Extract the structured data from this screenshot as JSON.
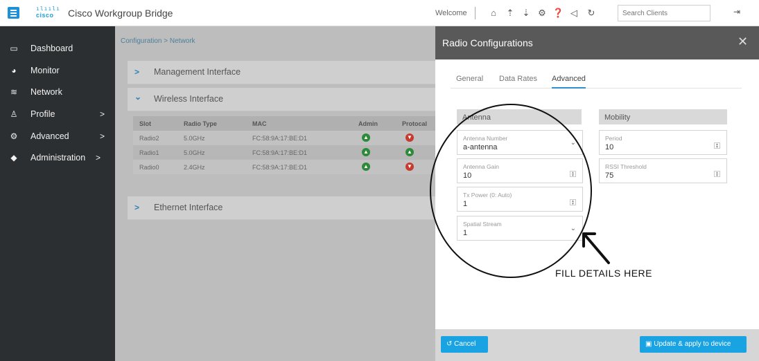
{
  "header": {
    "logo_word": "cisco",
    "logo_bars": "ılıılı",
    "title": "Cisco Workgroup Bridge",
    "welcome": "Welcome",
    "search_placeholder": "Search Clients",
    "icons": [
      "home-icon",
      "upload-icon",
      "download-icon",
      "gear-icon",
      "help-icon",
      "megaphone-icon",
      "refresh-icon",
      "logout-icon"
    ]
  },
  "sidebar": {
    "items": [
      {
        "label": "Dashboard",
        "icon": "dashboard-icon"
      },
      {
        "label": "Monitor",
        "icon": "monitor-icon"
      },
      {
        "label": "Network",
        "icon": "wifi-icon"
      },
      {
        "label": "Profile",
        "icon": "profile-icon",
        "chevron": ">"
      },
      {
        "label": "Advanced",
        "icon": "cogs-icon",
        "chevron": ">"
      },
      {
        "label": "Administration",
        "icon": "wrench-icon",
        "chevron": ">"
      }
    ]
  },
  "main": {
    "breadcrumb": "Configuration > Network",
    "panels": [
      {
        "label": "Management Interface",
        "arrow": ">"
      },
      {
        "label": "Wireless Interface",
        "arrow": "⌄"
      },
      {
        "label": "Ethernet Interface",
        "arrow": ">"
      }
    ],
    "table": {
      "columns": [
        "Slot",
        "Radio Type",
        "MAC",
        "Admin",
        "Protocal"
      ],
      "rows": [
        {
          "slot": "Radio2",
          "radio_type": "5.0GHz",
          "mac": "FC:58:9A:17:BE:D1",
          "admin": "up",
          "protocol": "down"
        },
        {
          "slot": "Radio1",
          "radio_type": "5.0GHz",
          "mac": "FC:58:9A:17:BE:D1",
          "admin": "up",
          "protocol": "up"
        },
        {
          "slot": "Radio0",
          "radio_type": "2.4GHz",
          "mac": "FC:58:9A:17:BE:D1",
          "admin": "up",
          "protocol": "down"
        }
      ]
    }
  },
  "drawer": {
    "title": "Radio Configurations",
    "close": "✕",
    "tabs": [
      "General",
      "Data Rates",
      "Advanced"
    ],
    "active_tab": "Advanced",
    "antenna": {
      "header": "Antenna",
      "fields": [
        {
          "label": "Antenna Number",
          "value": "a-antenna",
          "control": "select"
        },
        {
          "label": "Antenna Gain",
          "value": "10",
          "control": "number"
        },
        {
          "label": "Tx Power (0: Auto)",
          "value": "1",
          "control": "number"
        },
        {
          "label": "Spatial Stream",
          "value": "1",
          "control": "select"
        }
      ]
    },
    "mobility": {
      "header": "Mobility",
      "fields": [
        {
          "label": "Period",
          "value": "10",
          "control": "number"
        },
        {
          "label": "RSSI Threshold",
          "value": "75",
          "control": "number"
        }
      ]
    },
    "cancel_label": "Cancel",
    "update_label": "Update & apply to device"
  },
  "annotation": {
    "text": "FILL DETAILS HERE"
  },
  "colors": {
    "accent": "#1aa3e2",
    "sidebar_bg": "#2c2f31",
    "drawer_header": "#595959",
    "status_up": "#2c8a3a",
    "status_down": "#c83a2f"
  }
}
